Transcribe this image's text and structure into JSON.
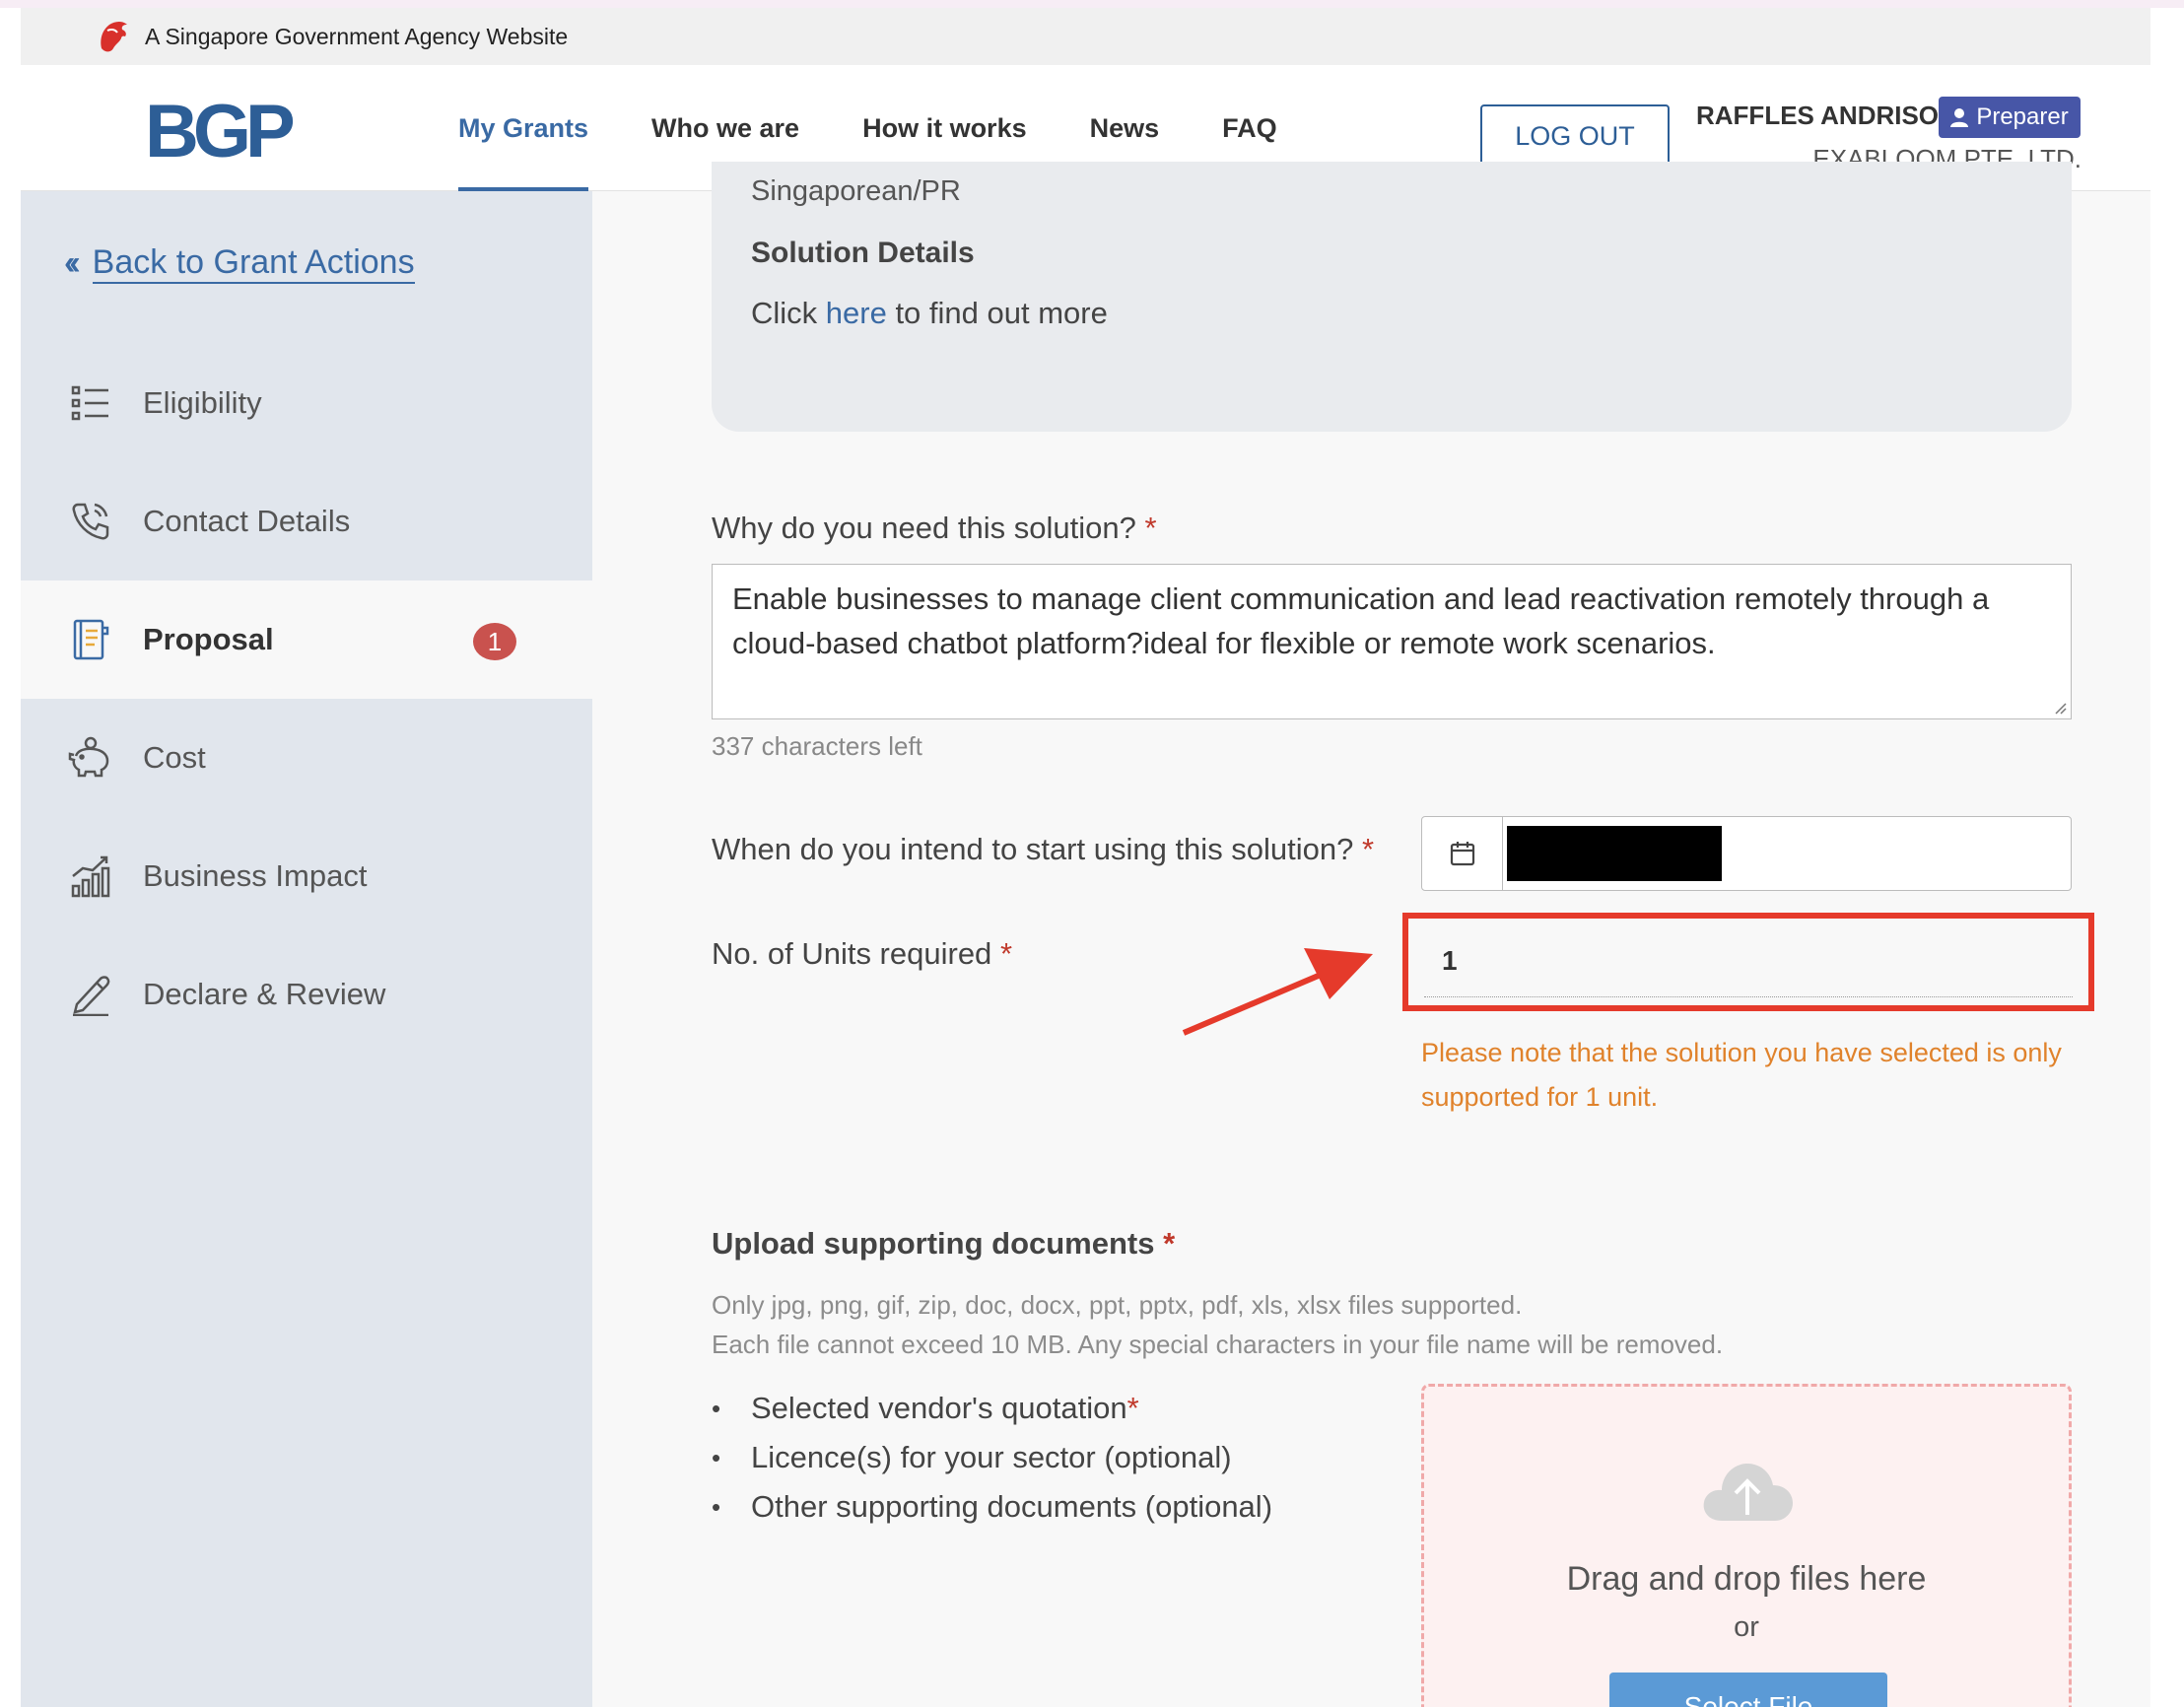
{
  "masthead": {
    "text": "A Singapore Government Agency Website"
  },
  "header": {
    "logo": "BGP",
    "nav": [
      {
        "label": "My Grants",
        "active": true
      },
      {
        "label": "Who we are"
      },
      {
        "label": "How it works"
      },
      {
        "label": "News"
      },
      {
        "label": "FAQ"
      }
    ],
    "logout_label": "LOG OUT",
    "user_name": "RAFFLES ANDRISON",
    "role": "Preparer",
    "company": "EXABLOOM PTE. LTD."
  },
  "sidebar": {
    "back_label": "Back to Grant Actions",
    "items": [
      {
        "label": "Eligibility",
        "icon": "list-icon"
      },
      {
        "label": "Contact Details",
        "icon": "phone-icon"
      },
      {
        "label": "Proposal",
        "icon": "notebook-icon",
        "active": true,
        "badge": "1"
      },
      {
        "label": "Cost",
        "icon": "piggy-bank-icon"
      },
      {
        "label": "Business Impact",
        "icon": "chart-icon"
      },
      {
        "label": "Declare & Review",
        "icon": "pen-icon"
      }
    ]
  },
  "proposal": {
    "info_prev": "Singaporean/PR",
    "solution_details_title": "Solution Details",
    "solution_details_prefix": "Click ",
    "solution_details_link": "here",
    "solution_details_suffix": " to find out more",
    "why_label": "Why do you need this solution?",
    "why_value": "Enable businesses to manage client communication and lead reactivation remotely through a cloud-based chatbot platform?ideal for flexible or remote work scenarios.",
    "chars_left": "337 characters left",
    "start_label": "When do you intend to start using this solution?",
    "units_label": "No. of Units required",
    "units_value": "1",
    "units_warning": "Please note that the solution you have selected is only supported for 1 unit.",
    "required_mark": "*",
    "upload": {
      "title": "Upload supporting documents",
      "note_line1": "Only jpg, png, gif, zip, doc, docx, ppt, pptx, pdf, xls, xlsx files supported.",
      "note_line2": "Each file cannot exceed 10 MB. Any special characters in your file name will be removed.",
      "docs": [
        {
          "label": "Selected vendor's quotation",
          "required": true
        },
        {
          "label": "Licence(s) for your sector (optional)"
        },
        {
          "label": "Other supporting documents (optional)"
        }
      ],
      "drop_text": "Drag and drop files here",
      "or_text": "or",
      "select_label": "Select File"
    }
  },
  "colors": {
    "accent": "#3a6aa4",
    "highlight": "#e53a2b",
    "warning": "#e0822b",
    "badge": "#c9524e"
  }
}
